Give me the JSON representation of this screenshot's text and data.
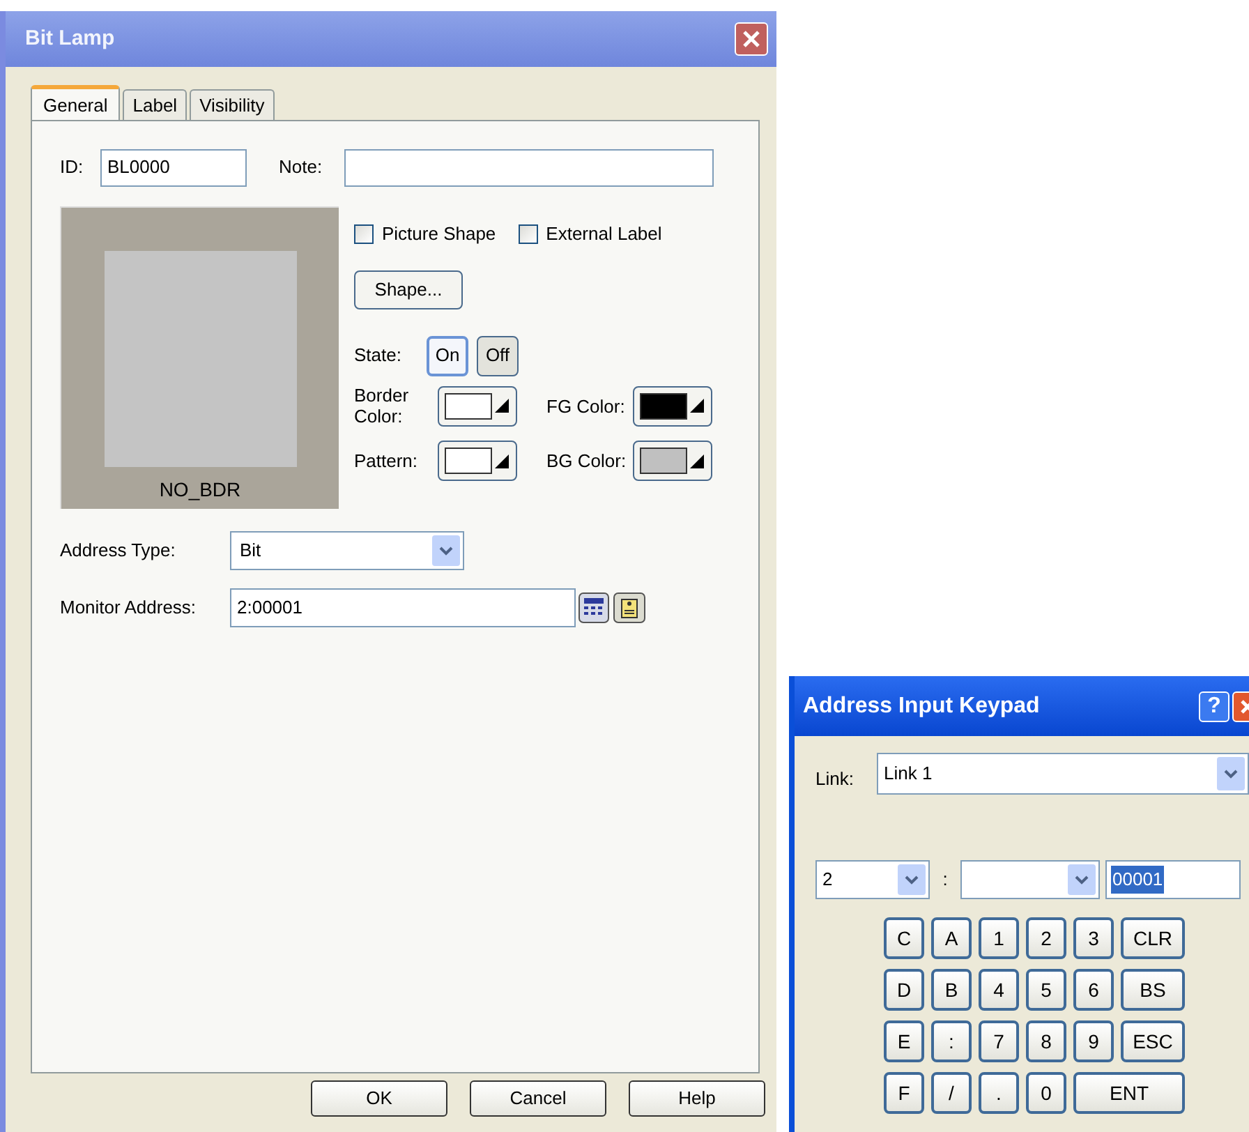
{
  "main_window": {
    "title": "Bit Lamp"
  },
  "tabs": [
    {
      "label": "General",
      "selected": true
    },
    {
      "label": "Label",
      "selected": false
    },
    {
      "label": "Visibility",
      "selected": false
    }
  ],
  "id_field": {
    "label": "ID:",
    "value": "BL0000"
  },
  "note_field": {
    "label": "Note:"
  },
  "preview": {
    "caption": "NO_BDR"
  },
  "checkboxes": [
    {
      "label": "Picture Shape",
      "checked": false
    },
    {
      "label": "External Label",
      "checked": false
    }
  ],
  "shape_button": "Shape...",
  "state": {
    "label": "State:",
    "options": [
      {
        "label": "On",
        "selected": true
      },
      {
        "label": "Off",
        "selected": false
      }
    ]
  },
  "color_pickers": [
    {
      "label": "Border Color:",
      "color": "#ffffff"
    },
    {
      "label": "FG Color:",
      "color": "#000000"
    },
    {
      "label": "Pattern:",
      "color": "#ffffff"
    },
    {
      "label": "BG Color:",
      "color": "#c0c0c0"
    }
  ],
  "address_type": {
    "label": "Address Type:",
    "value": "Bit"
  },
  "monitor_address": {
    "label": "Monitor Address:",
    "value": "2:00001"
  },
  "dialog_buttons": [
    "OK",
    "Cancel",
    "Help"
  ],
  "keypad_window": {
    "title": "Address Input Keypad",
    "help_button": "?"
  },
  "link": {
    "label": "Link:",
    "value": "Link 1"
  },
  "address_row": {
    "station": "2",
    "separator": ":",
    "number": {
      "value": "00001",
      "selected": true
    }
  },
  "keys": [
    [
      {
        "label": "C"
      },
      {
        "label": "A"
      },
      {
        "label": "1"
      },
      {
        "label": "2"
      },
      {
        "label": "3"
      },
      {
        "label": "CLR"
      }
    ],
    [
      {
        "label": "D"
      },
      {
        "label": "B"
      },
      {
        "label": "4"
      },
      {
        "label": "5"
      },
      {
        "label": "6"
      },
      {
        "label": "BS"
      }
    ],
    [
      {
        "label": "E"
      },
      {
        "label": ":"
      },
      {
        "label": "7"
      },
      {
        "label": "8"
      },
      {
        "label": "9"
      },
      {
        "label": "ESC"
      }
    ],
    [
      {
        "label": "F"
      },
      {
        "label": "/"
      },
      {
        "label": "."
      },
      {
        "label": "0"
      },
      {
        "label": "ENT",
        "wide": true
      }
    ]
  ]
}
